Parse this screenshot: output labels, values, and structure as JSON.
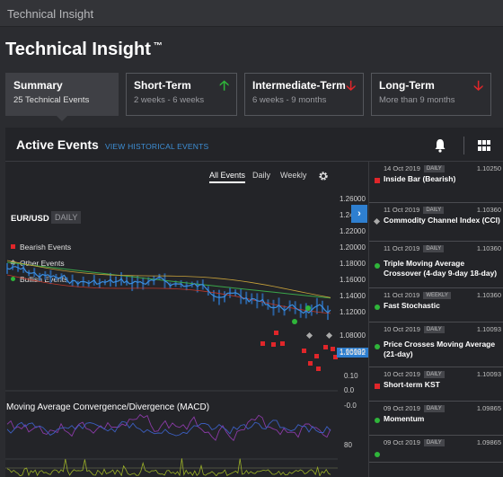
{
  "window": {
    "title": "Technical Insight"
  },
  "page": {
    "title": "Technical Insight",
    "trademark": "™"
  },
  "tabs": [
    {
      "title": "Summary",
      "subtitle": "25 Technical Events",
      "indicator": ""
    },
    {
      "title": "Short-Term",
      "subtitle": "2 weeks - 6 weeks",
      "indicator": "up"
    },
    {
      "title": "Intermediate-Term",
      "subtitle": "6 weeks - 9 months",
      "indicator": "down"
    },
    {
      "title": "Long-Term",
      "subtitle": "More than 9 months",
      "indicator": "down"
    }
  ],
  "panel": {
    "title": "Active Events",
    "history_link": "VIEW HISTORICAL EVENTS",
    "icons": [
      "bell-icon",
      "grid-icon"
    ]
  },
  "chart": {
    "timeframes": [
      "All Events",
      "Daily",
      "Weekly"
    ],
    "selected_timeframe": "All Events",
    "pair": "EUR/USD",
    "period": "DAILY",
    "legend": [
      "Bearish Events",
      "Other Events",
      "Bullish Events"
    ],
    "y_ticks": [
      "1.26000",
      "1.24000",
      "1.22000",
      "1.20000",
      "1.18000",
      "1.16000",
      "1.14000",
      "1.12000",
      "1.10182",
      "1.08000",
      "1.06000"
    ],
    "current_price": "1.10182",
    "macd_label": "Moving Average Convergence/Divergence (MACD)",
    "macd_ticks": [
      "0.10",
      "0.0",
      "-0.0"
    ],
    "osc_tick": "80",
    "colors": {
      "bearish": "#e0262a",
      "other": "#aaaaaa",
      "bullish": "#2fb53a",
      "accent": "#2e7fd0"
    }
  },
  "events": [
    {
      "date": "14 Oct 2019",
      "badge": "DAILY",
      "price": "1.10250",
      "type": "bearish",
      "title": "Inside Bar (Bearish)"
    },
    {
      "date": "11 Oct 2019",
      "badge": "DAILY",
      "price": "1.10360",
      "type": "other",
      "title": "Commodity Channel Index (CCI)"
    },
    {
      "date": "11 Oct 2019",
      "badge": "DAILY",
      "price": "1.10360",
      "type": "bullish",
      "title": "Triple Moving Average Crossover (4-day 9-day 18-day)"
    },
    {
      "date": "11 Oct 2019",
      "badge": "WEEKLY",
      "price": "1.10360",
      "type": "bullish",
      "title": "Fast Stochastic"
    },
    {
      "date": "10 Oct 2019",
      "badge": "DAILY",
      "price": "1.10093",
      "type": "bullish",
      "title": "Price Crosses Moving Average (21-day)"
    },
    {
      "date": "10 Oct 2019",
      "badge": "DAILY",
      "price": "1.10093",
      "type": "bearish",
      "title": "Short-term KST"
    },
    {
      "date": "09 Oct 2019",
      "badge": "DAILY",
      "price": "1.09865",
      "type": "bullish",
      "title": "Momentum"
    },
    {
      "date": "09 Oct 2019",
      "badge": "DAILY",
      "price": "1.09865",
      "type": "bullish",
      "title": ""
    }
  ]
}
